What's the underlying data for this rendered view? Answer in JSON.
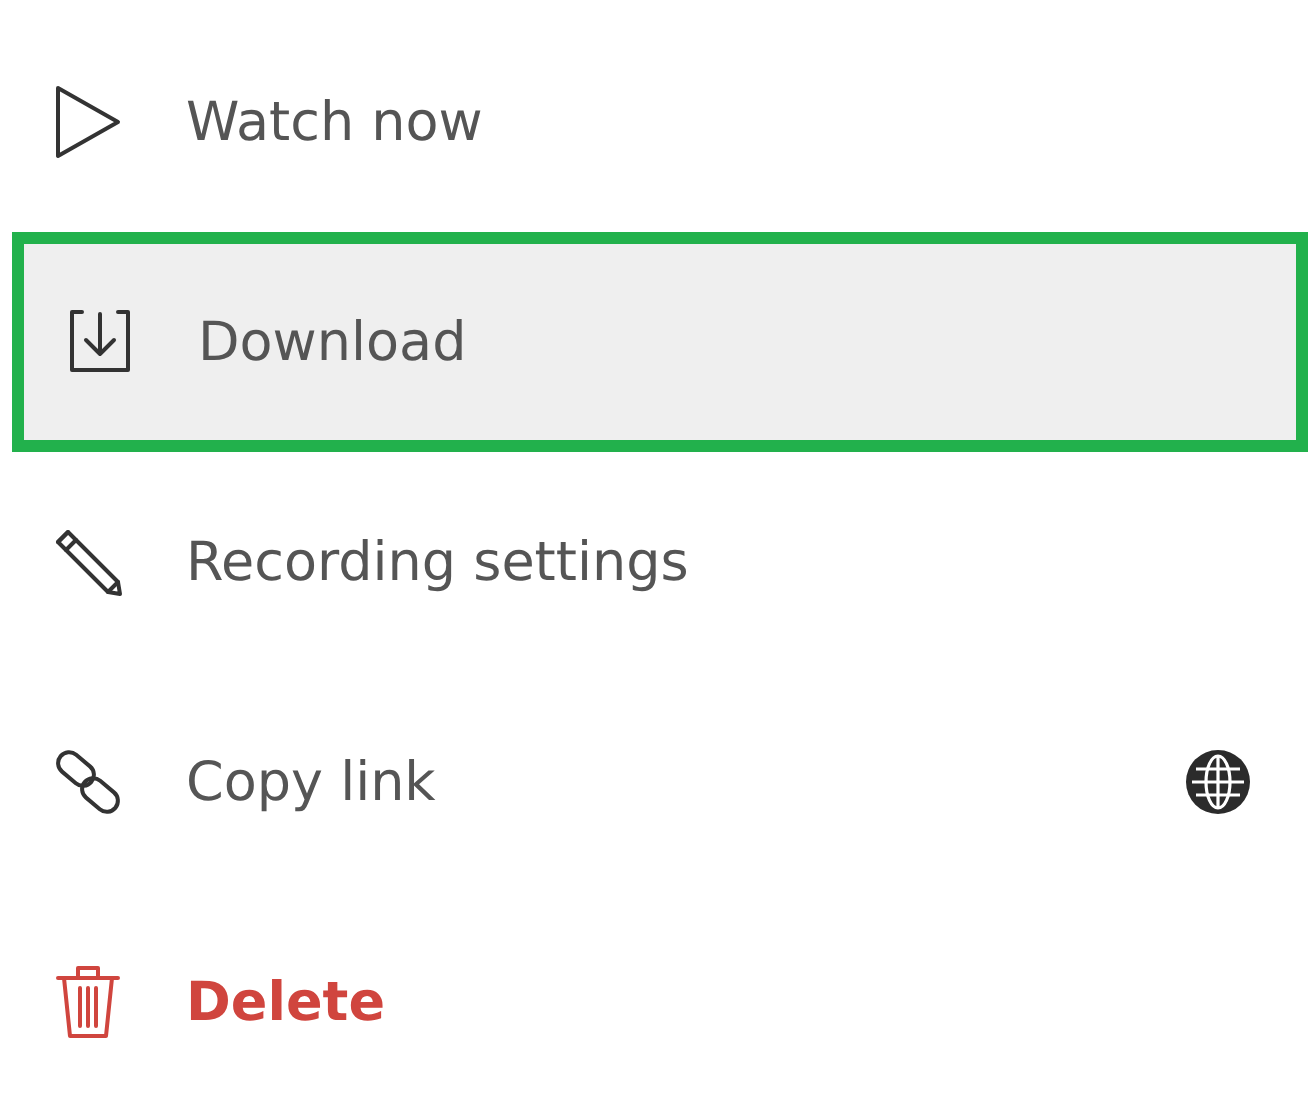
{
  "menu": {
    "items": [
      {
        "label": "Watch now",
        "selected": false,
        "danger": false,
        "public": false
      },
      {
        "label": "Download",
        "selected": true,
        "danger": false,
        "public": false
      },
      {
        "label": "Recording settings",
        "selected": false,
        "danger": false,
        "public": false
      },
      {
        "label": "Copy link",
        "selected": false,
        "danger": false,
        "public": true
      },
      {
        "label": "Delete",
        "selected": false,
        "danger": true,
        "public": false
      }
    ]
  }
}
